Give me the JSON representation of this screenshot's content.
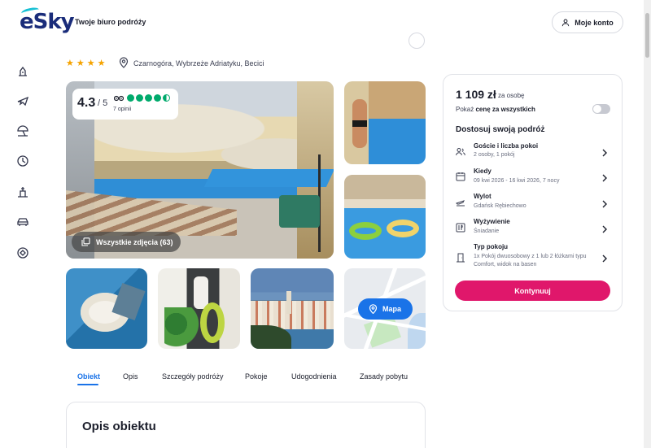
{
  "header": {
    "logo_text": "eSky",
    "tagline": "Twoje biuro podróży",
    "account_label": "Moje konto"
  },
  "sidebar": {
    "icons": [
      "hotel-icon",
      "flight-icon",
      "beach-umbrella-icon",
      "last-minute-icon",
      "city-break-icon",
      "car-icon",
      "ski-icon"
    ]
  },
  "hotel": {
    "stars": "★★★★",
    "location": "Czarnogóra, Wybrzeże Adriatyku, Becici"
  },
  "rating": {
    "score": "4.3",
    "max": "/ 5",
    "reviews": "7 opinii",
    "tripadvisor_dots": 4.5
  },
  "gallery": {
    "all_photos_label": "Wszystkie zdjęcia (63)",
    "map_label": "Mapa"
  },
  "tabs": [
    {
      "label": "Obiekt",
      "active": true
    },
    {
      "label": "Opis"
    },
    {
      "label": "Szczegóły podróży"
    },
    {
      "label": "Pokoje"
    },
    {
      "label": "Udogodnienia"
    },
    {
      "label": "Zasady pobytu"
    }
  ],
  "description": {
    "title": "Opis obiektu"
  },
  "booking": {
    "price": "1 109 zł",
    "price_unit": "za osobę",
    "toggle_prefix": "Pokaż",
    "toggle_bold": "cenę za wszystkich",
    "toggle_on": false,
    "customize_title": "Dostosuj swoją podróż",
    "options": [
      {
        "title": "Goście i liczba pokoi",
        "sub": "2 osoby, 1 pokój",
        "icon": "guests-icon"
      },
      {
        "title": "Kiedy",
        "sub": "09 kwi 2026 - 16 kwi 2026, 7 nocy",
        "icon": "calendar-icon"
      },
      {
        "title": "Wylot",
        "sub": "Gdańsk Rębiechowo",
        "icon": "departure-icon"
      },
      {
        "title": "Wyżywienie",
        "sub": "Śniadanie",
        "icon": "meal-icon"
      },
      {
        "title": "Typ pokoju",
        "sub": "1x Pokój dwuosobowy z 1 lub 2 łóżkami typu Comfort, widok na basen",
        "icon": "door-icon"
      }
    ],
    "continue_label": "Kontynuuj",
    "accent": "#e0176b"
  },
  "colors": {
    "brand": "#1a2c7a",
    "link": "#1a73e8",
    "tripadvisor": "#00aa6c",
    "stars": "#f5a300"
  }
}
